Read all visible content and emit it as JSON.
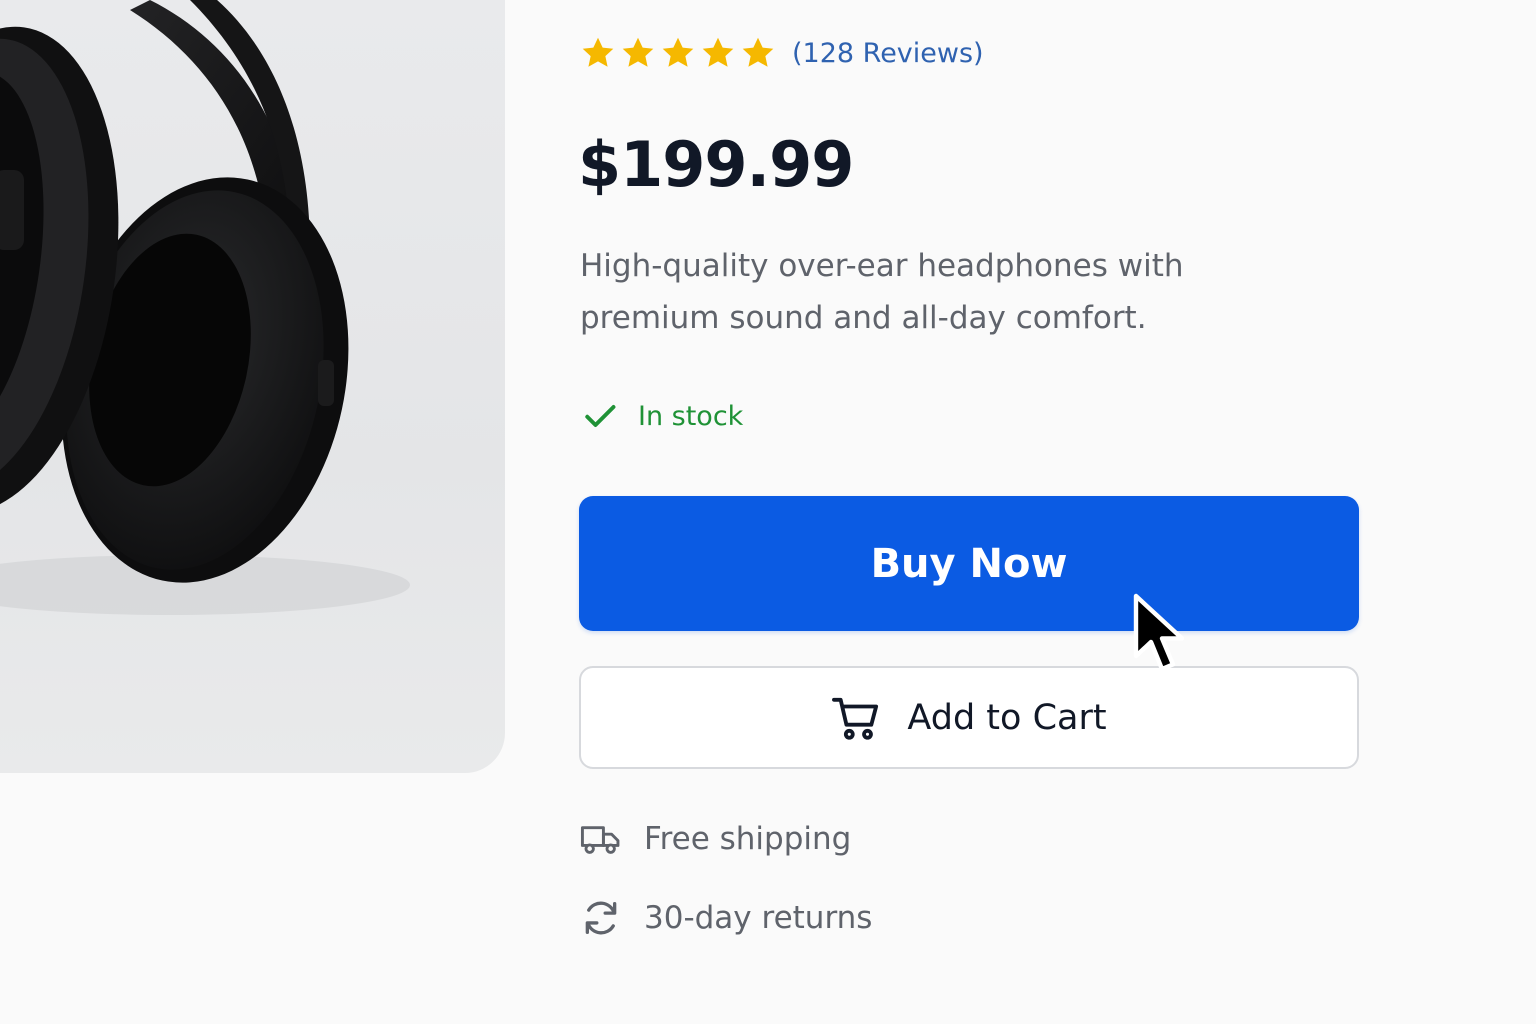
{
  "product": {
    "image_alt": "Black over-ear headphones",
    "rating": {
      "stars": 5,
      "max_stars": 5,
      "star_color": "#f5b800",
      "reviews_label": "(128 Reviews)"
    },
    "price": "$199.99",
    "description": "High-quality over-ear headphones with premium sound and all-day comfort.",
    "stock": {
      "status": "In stock",
      "color": "#1f9236",
      "icon": "check-icon"
    }
  },
  "actions": {
    "buy_now_label": "Buy Now",
    "buy_now_color": "#0b5be3",
    "add_to_cart_label": "Add to Cart",
    "add_to_cart_icon": "cart-icon"
  },
  "perks": [
    {
      "icon": "truck-icon",
      "label": "Free shipping"
    },
    {
      "icon": "refresh-icon",
      "label": "30-day returns"
    }
  ]
}
